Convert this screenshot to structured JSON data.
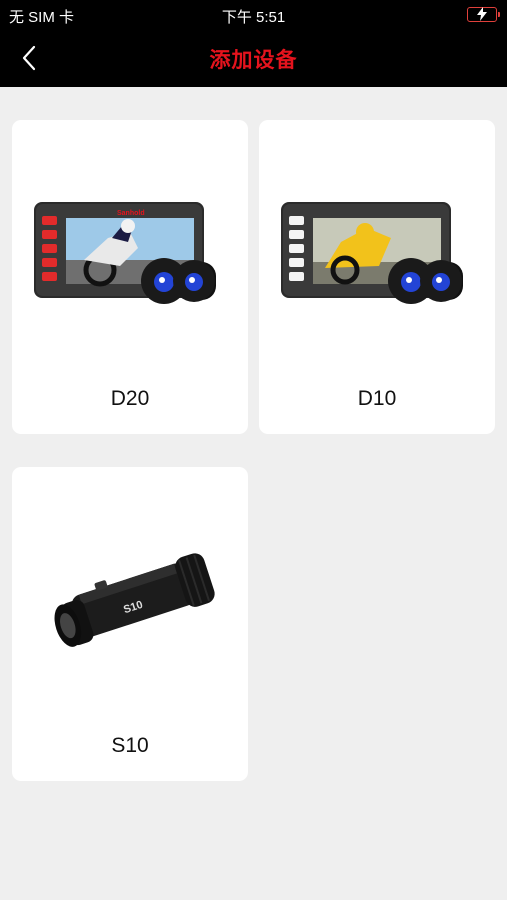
{
  "status": {
    "carrier": "无 SIM 卡",
    "time": "下午 5:51",
    "battery_state": "charging-low",
    "battery_color": "#e0403b"
  },
  "nav": {
    "title": "添加设备",
    "title_color": "#e5131d",
    "back_icon": "chevron-left-icon"
  },
  "devices": [
    {
      "name": "D20",
      "image": "dual-camera-d20-image",
      "screen_brand": "Sanhold"
    },
    {
      "name": "D10",
      "image": "dual-camera-d10-image"
    },
    {
      "name": "S10",
      "image": "bullet-camera-s10-image",
      "engraving": "S10"
    }
  ]
}
